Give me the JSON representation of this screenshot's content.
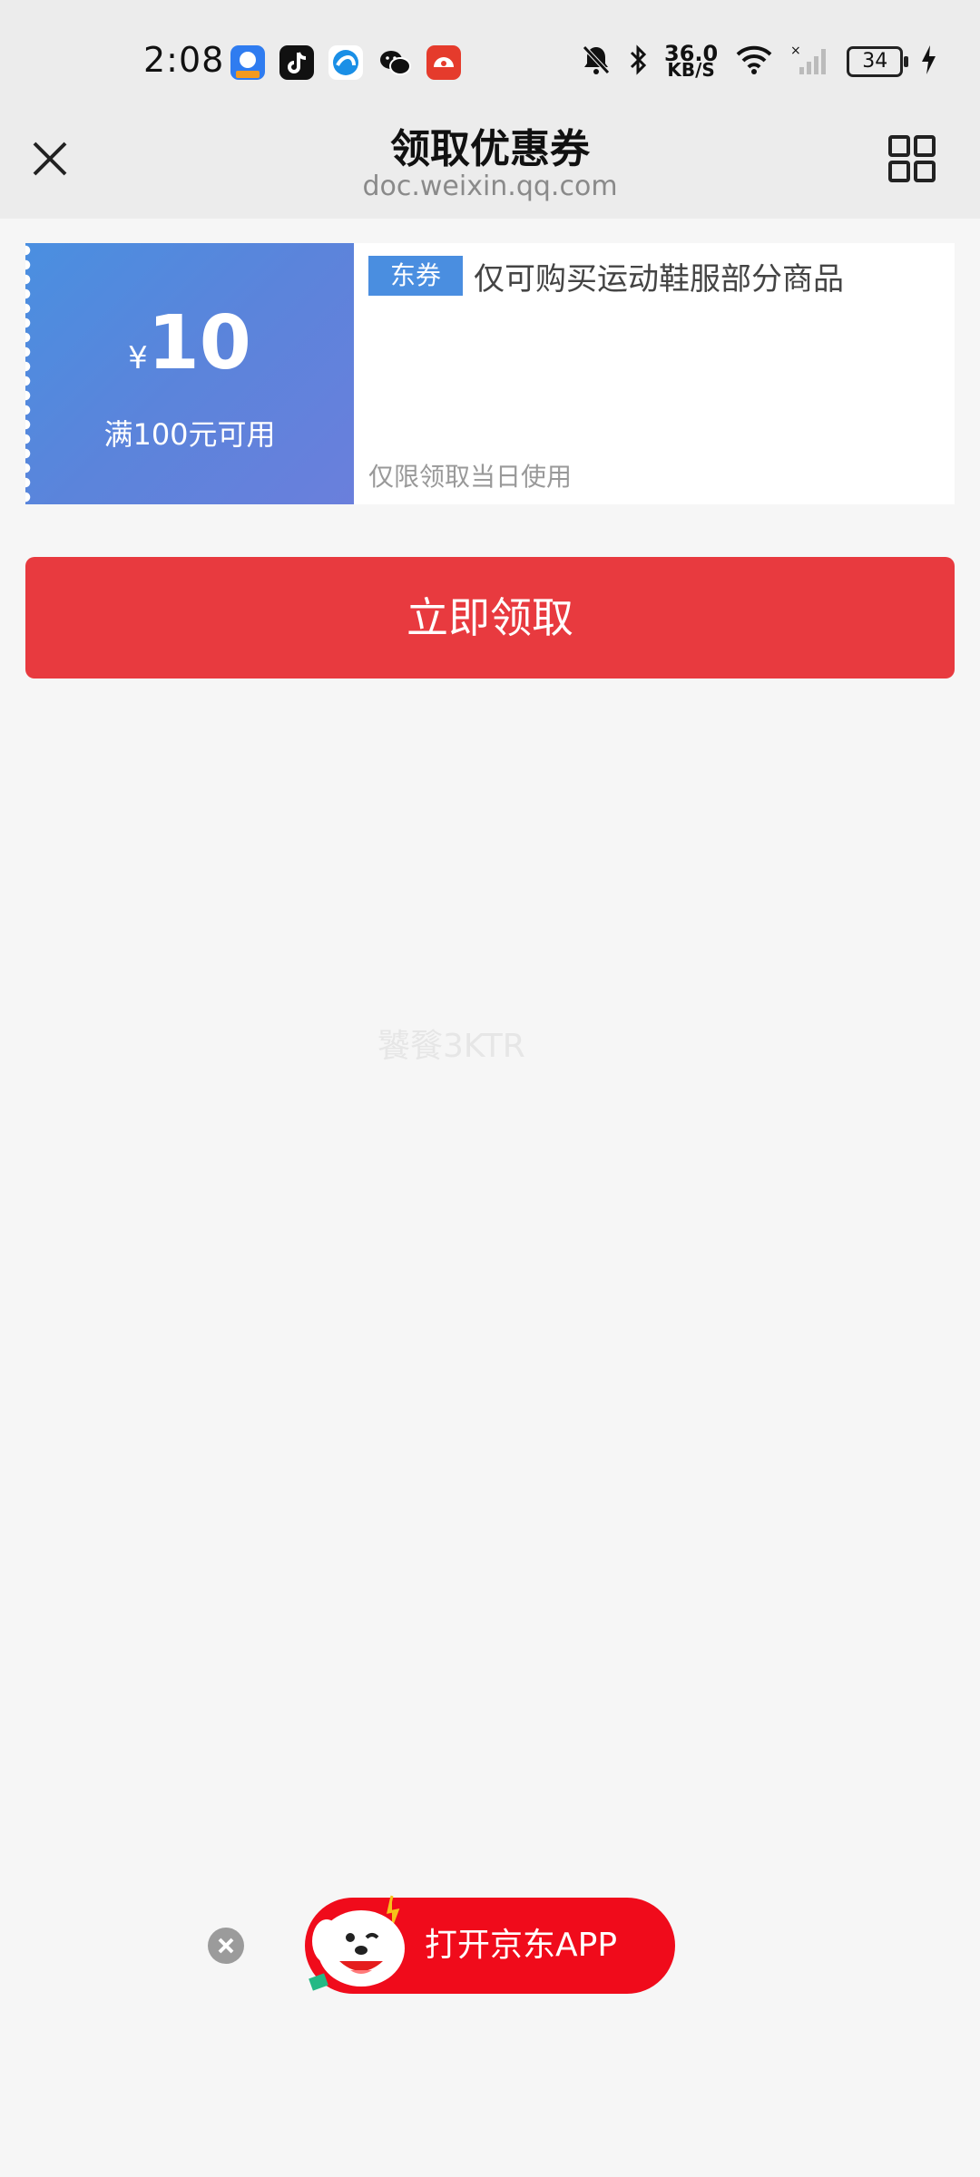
{
  "status_bar": {
    "time": "2:08",
    "network_speed": "36.0",
    "network_speed_unit": "KB/S",
    "battery": "34",
    "apps": [
      "tencent-app-icon",
      "tiktok-icon",
      "browser-icon",
      "wechat-icon",
      "pdd-icon"
    ],
    "indicators": [
      "mute-icon",
      "bluetooth-icon",
      "wifi-icon",
      "signal-icon",
      "charging-icon"
    ]
  },
  "nav": {
    "title": "领取优惠券",
    "subtitle": "doc.weixin.qq.com"
  },
  "coupon": {
    "currency": "¥",
    "amount": "10",
    "threshold": "满100元可用",
    "tag": "东券",
    "description": "仅可购买运动鞋服部分商品",
    "note": "仅限领取当日使用",
    "accent_color": "#4a8ee0"
  },
  "claim_button": {
    "label": "立即领取",
    "color": "#e83a3f"
  },
  "watermark": "饕餮3KTR",
  "open_app": {
    "label": "打开京东APP",
    "color": "#f00b1b"
  }
}
